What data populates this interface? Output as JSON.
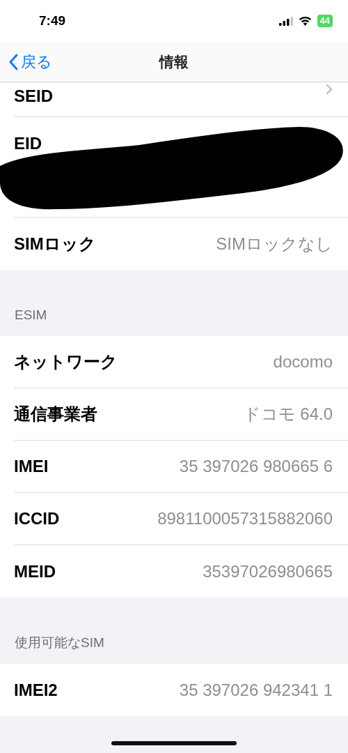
{
  "status_bar": {
    "time": "7:49",
    "battery": "44"
  },
  "nav": {
    "back": "戻る",
    "title": "情報"
  },
  "sections": [
    {
      "rows": [
        {
          "kind": "link",
          "label": "SEID"
        },
        {
          "kind": "redacted",
          "label": "EID"
        },
        {
          "kind": "value",
          "label": "SIMロック",
          "value": "SIMロックなし"
        }
      ]
    },
    {
      "header": "ESIM",
      "rows": [
        {
          "kind": "value",
          "label": "ネットワーク",
          "value": "docomo"
        },
        {
          "kind": "value",
          "label": "通信事業者",
          "value": "ドコモ 64.0"
        },
        {
          "kind": "value",
          "label": "IMEI",
          "value": "35 397026 980665 6"
        },
        {
          "kind": "value",
          "label": "ICCID",
          "value": "8981100057315882060"
        },
        {
          "kind": "value",
          "label": "MEID",
          "value": "35397026980665"
        }
      ]
    },
    {
      "header": "使用可能なSIM",
      "rows": [
        {
          "kind": "value",
          "label": "IMEI2",
          "value": "35 397026 942341 1"
        }
      ]
    }
  ]
}
